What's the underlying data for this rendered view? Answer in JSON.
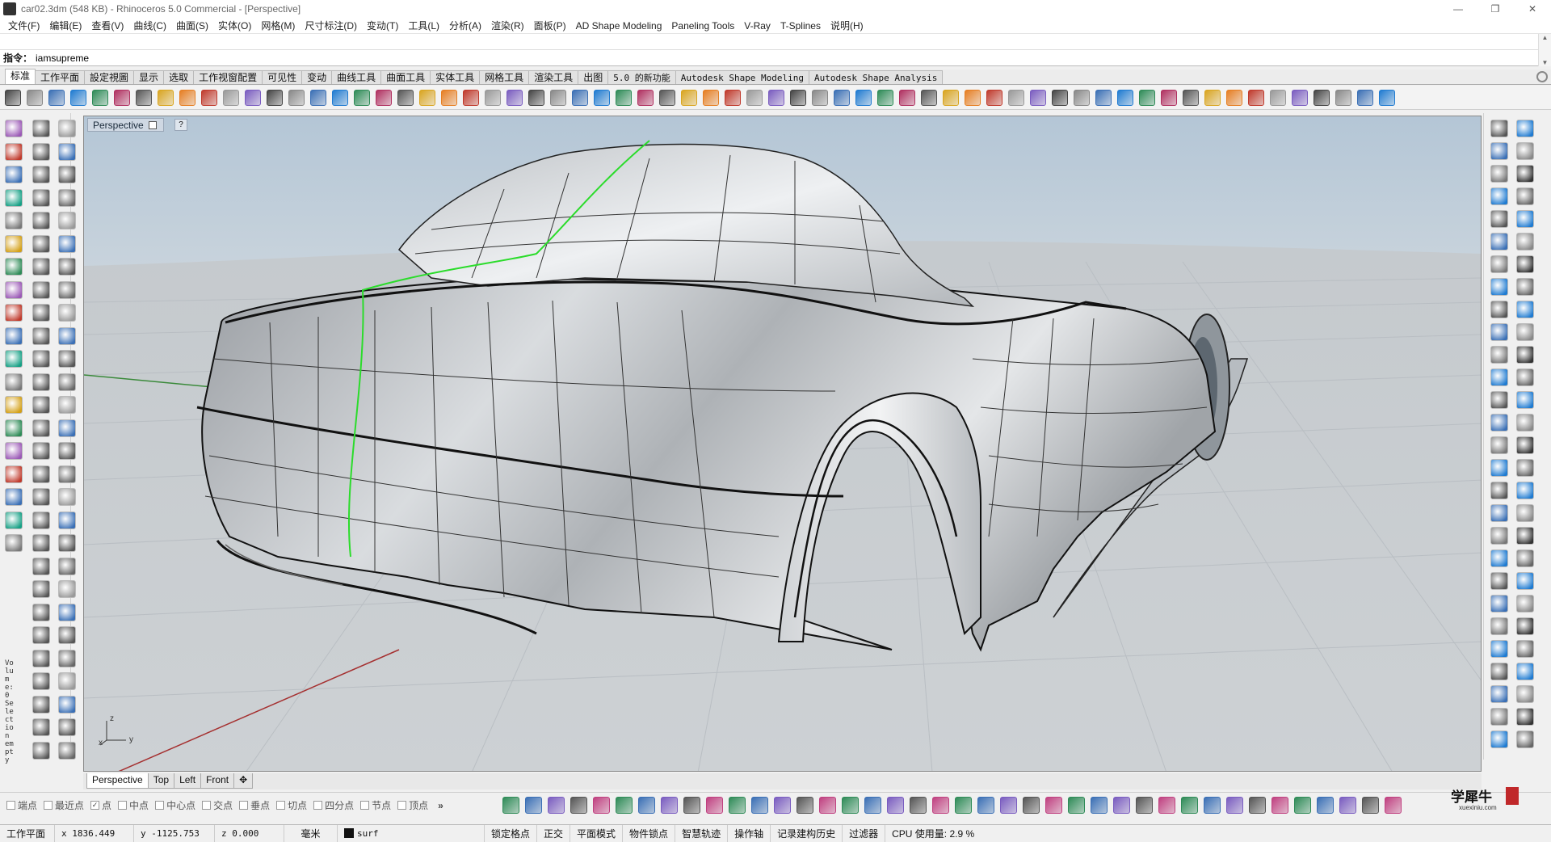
{
  "window": {
    "title": "car02.3dm (548 KB) - Rhinoceros 5.0 Commercial - [Perspective]",
    "minimize": "—",
    "maximize": "❐",
    "close": "✕"
  },
  "menu": [
    "文件(F)",
    "编辑(E)",
    "查看(V)",
    "曲线(C)",
    "曲面(S)",
    "实体(O)",
    "网格(M)",
    "尺寸标注(D)",
    "变动(T)",
    "工具(L)",
    "分析(A)",
    "渲染(R)",
    "面板(P)",
    "AD Shape Modeling",
    "Paneling Tools",
    "V-Ray",
    "T-Splines",
    "说明(H)"
  ],
  "command": {
    "label": "指令：",
    "value": "iamsupreme"
  },
  "toolbar_tabs": [
    {
      "label": "标准",
      "active": true
    },
    {
      "label": "工作平面"
    },
    {
      "label": "設定視圖"
    },
    {
      "label": "显示"
    },
    {
      "label": "选取"
    },
    {
      "label": "工作视窗配置"
    },
    {
      "label": "可见性"
    },
    {
      "label": "变动"
    },
    {
      "label": "曲线工具"
    },
    {
      "label": "曲面工具"
    },
    {
      "label": "实体工具"
    },
    {
      "label": "网格工具"
    },
    {
      "label": "渲染工具"
    },
    {
      "label": "出图"
    },
    {
      "label": "5.0 的新功能"
    },
    {
      "label": "Autodesk Shape Modeling"
    },
    {
      "label": "Autodesk Shape Analysis"
    }
  ],
  "viewport": {
    "name": "Perspective",
    "axis_labels": {
      "z": "z",
      "x": "x",
      "y": "y"
    }
  },
  "left_panel": {
    "status_text": "Volume: 0 Selection empty"
  },
  "view_tabs": [
    "Perspective",
    "Top",
    "Left",
    "Front"
  ],
  "view_tab_add": "✥",
  "osnaps": [
    {
      "label": "端点",
      "checked": false
    },
    {
      "label": "最近点",
      "checked": false
    },
    {
      "label": "点",
      "checked": true
    },
    {
      "label": "中点",
      "checked": false
    },
    {
      "label": "中心点",
      "checked": false
    },
    {
      "label": "交点",
      "checked": false
    },
    {
      "label": "垂点",
      "checked": false
    },
    {
      "label": "切点",
      "checked": false
    },
    {
      "label": "四分点",
      "checked": false
    },
    {
      "label": "节点",
      "checked": false
    },
    {
      "label": "顶点",
      "checked": false
    }
  ],
  "osnap_more": "»",
  "watermark": {
    "big": "学犀牛",
    "small": "xuexiniu.com"
  },
  "status": {
    "cplane": "工作平面",
    "x": "x 1836.449",
    "y": "y -1125.753",
    "z": "z 0.000",
    "units": "毫米",
    "layer": "surf",
    "buttons": [
      "锁定格点",
      "正交",
      "平面模式",
      "物件锁点",
      "智慧轨迹",
      "操作轴",
      "记录建构历史",
      "过滤器"
    ],
    "cpu": "CPU 使用量: 2.9 %"
  },
  "colors": {
    "accent_curve": "#2bdc2b",
    "viewport_sky": "#b9cad8",
    "viewport_ground": "#c7ccd0"
  }
}
